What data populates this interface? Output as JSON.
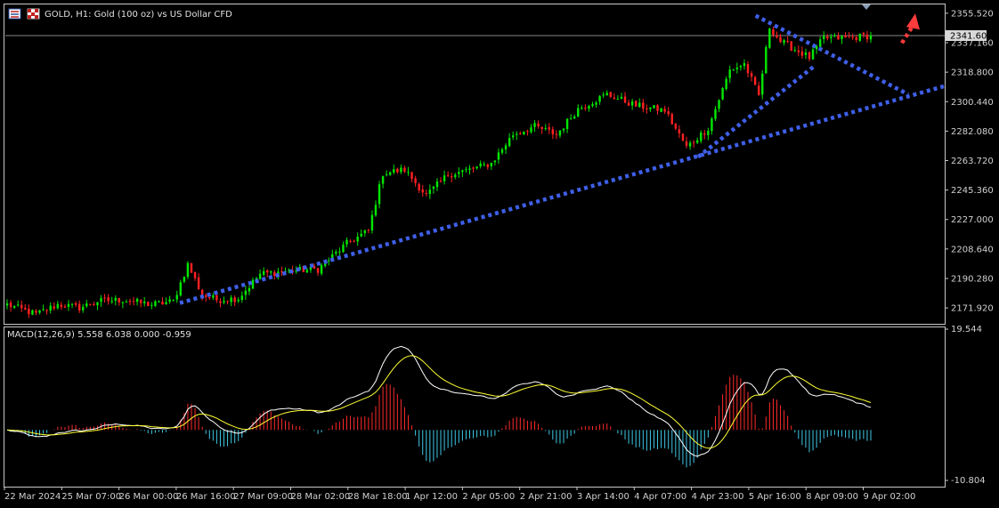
{
  "header": {
    "title": "GOLD, H1:  Gold (100 oz) vs US Dollar CFD",
    "chart_icon": "bar-chart-icon",
    "flag_icon": "checkered-flag-icon"
  },
  "indicator": {
    "label": "MACD(12,26,9) 5.558 6.038 0.000 -0.959"
  },
  "colors": {
    "background": "#000000",
    "frame": "#c8c8c8",
    "bull_candle": "#00e600",
    "bear_candle": "#ff2020",
    "trendline": "#3f5fe8",
    "arrow": "#ff3b3b",
    "macd_line": "#ffffff",
    "signal_line": "#ffff33",
    "hist_positive": "#ff2a2a",
    "hist_negative": "#3ec9e8",
    "current_price_line": "#888888"
  },
  "chart_data": [
    {
      "type": "candlestick",
      "title": "GOLD, H1:  Gold (100 oz) vs US Dollar CFD",
      "ylim": [
        2162.0,
        2361.0
      ],
      "y_ticks": [
        "2355.520",
        "2337.160",
        "2318.800",
        "2300.440",
        "2282.080",
        "2263.720",
        "2245.360",
        "2227.000",
        "2208.640",
        "2190.280",
        "2171.920"
      ],
      "y_tick_values": [
        2355.52,
        2337.16,
        2318.8,
        2300.44,
        2282.08,
        2263.72,
        2245.36,
        2227.0,
        2208.64,
        2190.28,
        2171.92
      ],
      "current_price": "2341.600",
      "current_price_value": 2341.6,
      "x_ticks": [
        "22 Mar 2024",
        "25 Mar 07:00",
        "26 Mar 00:00",
        "26 Mar 16:00",
        "27 Mar 09:00",
        "28 Mar 02:00",
        "28 Mar 18:00",
        "1 Apr 12:00",
        "2 Apr 05:00",
        "2 Apr 21:00",
        "3 Apr 14:00",
        "4 Apr 07:00",
        "4 Apr 23:00",
        "5 Apr 16:00",
        "8 Apr 09:00",
        "9 Apr 02:00"
      ],
      "n_bars": 240,
      "close_anchors": [
        [
          0,
          2174
        ],
        [
          8,
          2168
        ],
        [
          14,
          2174
        ],
        [
          20,
          2172
        ],
        [
          25,
          2176
        ],
        [
          32,
          2177
        ],
        [
          40,
          2174
        ],
        [
          46,
          2176
        ],
        [
          50,
          2199
        ],
        [
          54,
          2180
        ],
        [
          58,
          2177
        ],
        [
          64,
          2178
        ],
        [
          70,
          2193
        ],
        [
          78,
          2195
        ],
        [
          86,
          2196
        ],
        [
          94,
          2212
        ],
        [
          100,
          2220
        ],
        [
          104,
          2256
        ],
        [
          110,
          2258
        ],
        [
          116,
          2242
        ],
        [
          122,
          2255
        ],
        [
          128,
          2258
        ],
        [
          134,
          2262
        ],
        [
          140,
          2280
        ],
        [
          146,
          2285
        ],
        [
          152,
          2280
        ],
        [
          158,
          2296
        ],
        [
          166,
          2305
        ],
        [
          174,
          2298
        ],
        [
          182,
          2295
        ],
        [
          188,
          2272
        ],
        [
          194,
          2284
        ],
        [
          200,
          2320
        ],
        [
          204,
          2324
        ],
        [
          208,
          2304
        ],
        [
          211,
          2347
        ],
        [
          214,
          2338
        ],
        [
          218,
          2333
        ],
        [
          222,
          2328
        ],
        [
          226,
          2340
        ],
        [
          232,
          2340
        ],
        [
          239,
          2341.6
        ]
      ],
      "trendlines": [
        {
          "name": "rising-support",
          "points": [
            [
              "26 Mar 16:00",
              2175
            ],
            [
              "9 Apr 02:00",
              2310
            ]
          ]
        },
        {
          "name": "upper-flag",
          "points": [
            [
              "5 Apr 16:00",
              2354
            ],
            [
              "9 Apr 02:00",
              2305
            ]
          ]
        },
        {
          "name": "lower-flag",
          "points": [
            [
              "4 Apr 23:00",
              2266
            ],
            [
              "8 Apr 09:00",
              2322
            ]
          ]
        }
      ],
      "arrow": {
        "direction": "up",
        "from": [
          "9 Apr 02:00",
          2337
        ],
        "to": [
          "9 Apr 02:00",
          2352
        ]
      }
    },
    {
      "type": "bar+line",
      "title": "MACD(12,26,9) 5.558 6.038 0.000 -0.959",
      "ylim": [
        -10.804,
        19.544
      ],
      "y_ticks": [
        "19.544",
        "-10.804"
      ],
      "series": [
        {
          "name": "MACD(12,26,9)",
          "values_at_last": 5.558
        },
        {
          "name": "Signal",
          "values_at_last": 6.038
        }
      ]
    }
  ]
}
